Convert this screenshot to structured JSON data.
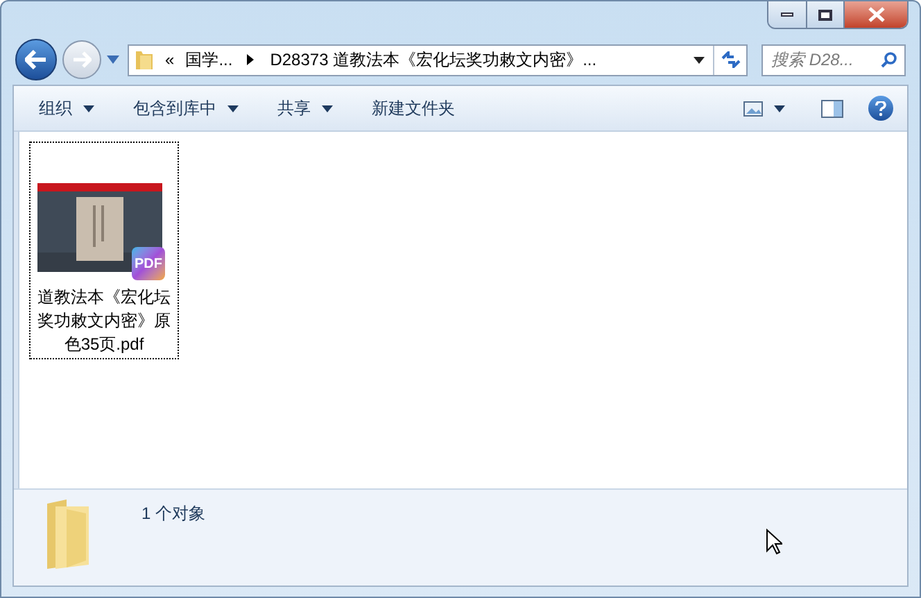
{
  "address": {
    "crumbs": [
      "«",
      "国学...",
      "D28373 道教法本《宏化坛奖功敕文内密》..."
    ]
  },
  "search": {
    "placeholder": "搜索 D28..."
  },
  "toolbar": {
    "items": [
      "组织",
      "包含到库中",
      "共享",
      "新建文件夹"
    ],
    "dropdown": [
      true,
      true,
      true,
      false
    ]
  },
  "files": [
    {
      "name": "道教法本《宏化坛奖功敕文内密》原色35页.pdf",
      "badge": "PDF",
      "selected": true
    }
  ],
  "status": {
    "text": "1 个对象"
  }
}
